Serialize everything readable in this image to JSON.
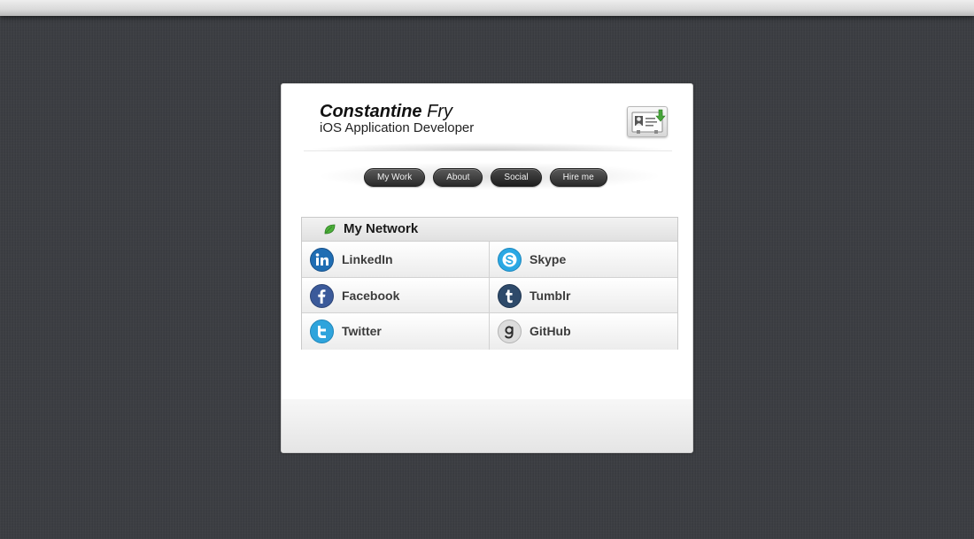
{
  "profile": {
    "first_name": "Constantine",
    "last_name": "Fry",
    "title": "iOS Application Developer"
  },
  "nav": [
    {
      "label": "My Work"
    },
    {
      "label": "About"
    },
    {
      "label": "Social"
    },
    {
      "label": "Hire me"
    }
  ],
  "active_nav": "Social",
  "network": {
    "title": "My Network",
    "items": [
      {
        "label": "LinkedIn",
        "icon": "linkedin-icon",
        "color": "#1f6db3"
      },
      {
        "label": "Skype",
        "icon": "skype-icon",
        "color": "#2ba8e4"
      },
      {
        "label": "Facebook",
        "icon": "facebook-icon",
        "color": "#3b5a9a"
      },
      {
        "label": "Tumblr",
        "icon": "tumblr-icon",
        "color": "#2e4a6a"
      },
      {
        "label": "Twitter",
        "icon": "twitter-icon",
        "color": "#2fa4dc"
      },
      {
        "label": "GitHub",
        "icon": "github-icon",
        "color": "#d8d8d8"
      }
    ]
  }
}
